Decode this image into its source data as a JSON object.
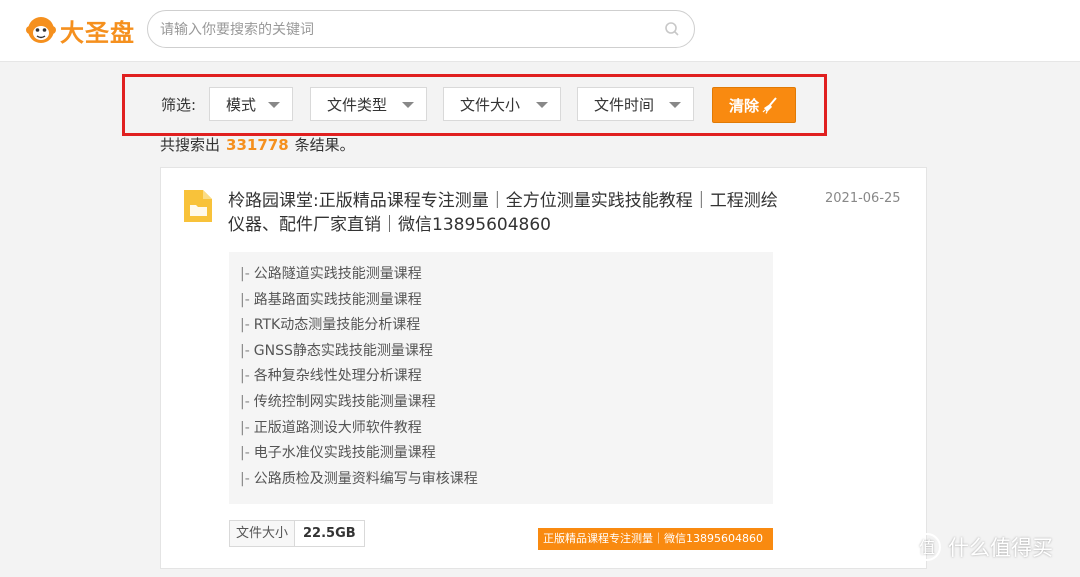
{
  "header": {
    "logo_text": "大圣盘",
    "search_placeholder": "请输入你要搜索的关键词"
  },
  "filters": {
    "label": "筛选:",
    "mode": "模式",
    "file_type": "文件类型",
    "file_size": "文件大小",
    "file_time": "文件时间",
    "clear": "清除"
  },
  "results": {
    "prefix": "共搜索出",
    "count": "331778",
    "suffix": "条结果。"
  },
  "result_card": {
    "title": "柃路园课堂:正版精品课程专注测量｜全方位测量实践技能教程｜工程测绘仪器、配件厂家直销｜微信13895604860",
    "date": "2021-06-25",
    "files": [
      "公路隧道实践技能测量课程",
      "路基路面实践技能测量课程",
      "RTK动态测量技能分析课程",
      "GNSS静态实践技能测量课程",
      "各种复杂线性处理分析课程",
      "传统控制网实践技能测量课程",
      "正版道路测设大师软件教程",
      "电子水准仪实践技能测量课程",
      "公路质检及测量资料编写与审核课程"
    ],
    "file_prefix": "|-",
    "size_label": "文件大小",
    "size_value": "22.5GB",
    "tag": "正版精品课程专注测量｜微信13895604860"
  },
  "watermark": "什么值得买",
  "colors": {
    "accent": "#f98a10",
    "highlight_border": "#e02020"
  }
}
